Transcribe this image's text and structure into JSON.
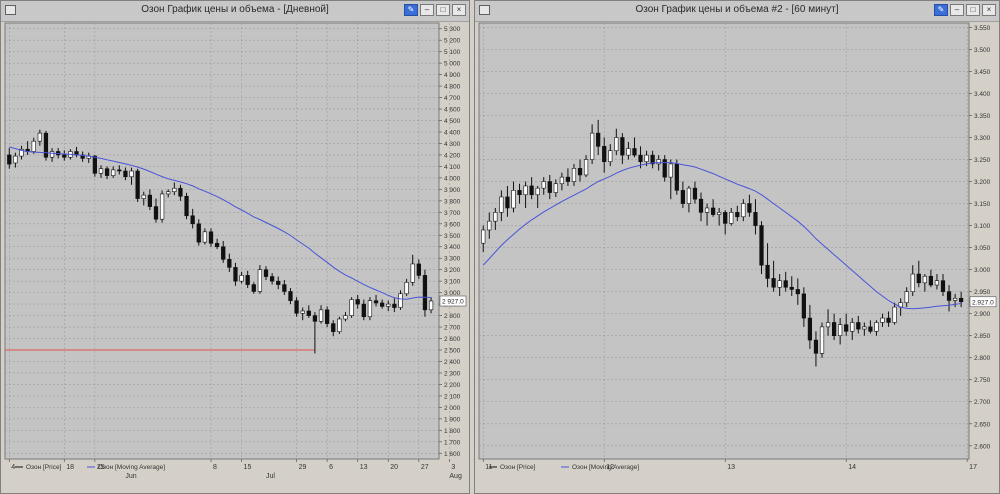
{
  "windows": [
    {
      "title": "Озон График цены и объема - [Дневной]",
      "legend": [
        "Озон [Price]",
        "Озон [Moving Average]"
      ]
    },
    {
      "title": "Озон График цены и объема #2 - [60 минут]",
      "legend": [
        "Озон [Price]",
        "Озон [Moving Average]"
      ]
    }
  ],
  "chart_data": [
    {
      "type": "candlestick",
      "timeframe": "Дневной",
      "ylim": [
        1550,
        5350
      ],
      "yticks": [
        1600,
        1700,
        1800,
        1900,
        2000,
        2100,
        2200,
        2300,
        2400,
        2500,
        2600,
        2700,
        2800,
        2900,
        3000,
        3100,
        3200,
        3300,
        3400,
        3500,
        3600,
        3700,
        3800,
        3900,
        4000,
        4100,
        4200,
        4300,
        4400,
        4500,
        4600,
        4700,
        4800,
        4900,
        5000,
        5100,
        5200,
        5300
      ],
      "ytick_labels": [
        "1 600",
        "1 700",
        "1 800",
        "1 900",
        "2 000",
        "2 100",
        "2 200",
        "2 300",
        "2 400",
        "2 500",
        "2 600",
        "2 700",
        "2 800",
        "2 900",
        "3 000",
        "3 100",
        "3 200",
        "3 300",
        "3 400",
        "3 500",
        "3 600",
        "3 700",
        "3 800",
        "3 900",
        "4 000",
        "4 100",
        "4 200",
        "4 300",
        "4 400",
        "4 500",
        "4 600",
        "4 700",
        "4 800",
        "4 900",
        "5 000",
        "5 100",
        "5 200",
        "5 300"
      ],
      "xticks": [
        {
          "label": "4",
          "index": 0
        },
        {
          "label": "18",
          "index": 9
        },
        {
          "label": "25",
          "index": 14
        },
        {
          "label": "8",
          "index": 33
        },
        {
          "label": "15",
          "index": 38
        },
        {
          "label": "29",
          "index": 47
        },
        {
          "label": "6",
          "index": 52
        },
        {
          "label": "13",
          "index": 57
        },
        {
          "label": "20",
          "index": 62
        },
        {
          "label": "27",
          "index": 67
        },
        {
          "label": "3",
          "index": 72
        },
        {
          "label": "10",
          "index": 77
        }
      ],
      "month_labels": [
        {
          "label": "Jun",
          "index": 19
        },
        {
          "label": "Jul",
          "index": 42
        },
        {
          "label": "Aug",
          "index": 72
        }
      ],
      "hline": {
        "value": 2500,
        "color": "#e05050"
      },
      "last_price_label": "2 927.0",
      "last_price": 2927,
      "price_series_color": "#111111",
      "ma_color": "#4a54d8",
      "candles": [
        [
          4200,
          4260,
          4080,
          4120
        ],
        [
          4130,
          4220,
          4090,
          4190
        ],
        [
          4190,
          4280,
          4160,
          4250
        ],
        [
          4250,
          4320,
          4200,
          4230
        ],
        [
          4230,
          4350,
          4210,
          4320
        ],
        [
          4320,
          4420,
          4280,
          4390
        ],
        [
          4390,
          4410,
          4150,
          4180
        ],
        [
          4180,
          4260,
          4140,
          4230
        ],
        [
          4230,
          4260,
          4170,
          4200
        ],
        [
          4200,
          4240,
          4150,
          4180
        ],
        [
          4180,
          4250,
          4160,
          4230
        ],
        [
          4230,
          4270,
          4180,
          4200
        ],
        [
          4200,
          4230,
          4140,
          4170
        ],
        [
          4170,
          4220,
          4130,
          4190
        ],
        [
          4190,
          4200,
          4010,
          4040
        ],
        [
          4040,
          4110,
          4000,
          4080
        ],
        [
          4080,
          4100,
          3990,
          4020
        ],
        [
          4020,
          4100,
          4000,
          4070
        ],
        [
          4070,
          4110,
          4030,
          4060
        ],
        [
          4060,
          4090,
          3980,
          4010
        ],
        [
          4010,
          4090,
          3940,
          4060
        ],
        [
          4060,
          4080,
          3790,
          3820
        ],
        [
          3820,
          3880,
          3760,
          3850
        ],
        [
          3850,
          3900,
          3720,
          3750
        ],
        [
          3750,
          3820,
          3610,
          3640
        ],
        [
          3640,
          3890,
          3610,
          3860
        ],
        [
          3860,
          3900,
          3830,
          3880
        ],
        [
          3880,
          3960,
          3850,
          3910
        ],
        [
          3910,
          3940,
          3800,
          3840
        ],
        [
          3840,
          3870,
          3640,
          3670
        ],
        [
          3670,
          3730,
          3560,
          3600
        ],
        [
          3600,
          3640,
          3410,
          3440
        ],
        [
          3440,
          3560,
          3420,
          3530
        ],
        [
          3530,
          3560,
          3400,
          3430
        ],
        [
          3430,
          3470,
          3380,
          3400
        ],
        [
          3400,
          3450,
          3260,
          3290
        ],
        [
          3290,
          3340,
          3180,
          3220
        ],
        [
          3220,
          3260,
          3060,
          3100
        ],
        [
          3100,
          3180,
          3080,
          3150
        ],
        [
          3150,
          3190,
          3040,
          3070
        ],
        [
          3070,
          3090,
          2990,
          3010
        ],
        [
          3010,
          3240,
          2990,
          3200
        ],
        [
          3200,
          3230,
          3110,
          3140
        ],
        [
          3140,
          3170,
          3070,
          3100
        ],
        [
          3100,
          3140,
          3030,
          3070
        ],
        [
          3070,
          3110,
          2980,
          3010
        ],
        [
          3010,
          3040,
          2900,
          2930
        ],
        [
          2930,
          2960,
          2790,
          2820
        ],
        [
          2820,
          2870,
          2760,
          2840
        ],
        [
          2840,
          2890,
          2780,
          2800
        ],
        [
          2800,
          2830,
          2470,
          2750
        ],
        [
          2750,
          2890,
          2730,
          2850
        ],
        [
          2850,
          2880,
          2700,
          2730
        ],
        [
          2730,
          2760,
          2620,
          2660
        ],
        [
          2660,
          2790,
          2640,
          2770
        ],
        [
          2770,
          2830,
          2750,
          2800
        ],
        [
          2800,
          2960,
          2780,
          2940
        ],
        [
          2940,
          2980,
          2860,
          2900
        ],
        [
          2900,
          2940,
          2760,
          2790
        ],
        [
          2790,
          2960,
          2760,
          2930
        ],
        [
          2930,
          2980,
          2880,
          2910
        ],
        [
          2910,
          2940,
          2860,
          2880
        ],
        [
          2880,
          2930,
          2840,
          2900
        ],
        [
          2900,
          2950,
          2830,
          2870
        ],
        [
          2870,
          3020,
          2850,
          2990
        ],
        [
          2990,
          3120,
          2970,
          3090
        ],
        [
          3090,
          3330,
          3060,
          3250
        ],
        [
          3250,
          3290,
          3120,
          3150
        ],
        [
          3150,
          3200,
          2790,
          2850
        ],
        [
          2850,
          2960,
          2820,
          2927
        ]
      ],
      "ma": [
        4270,
        4255,
        4240,
        4230,
        4225,
        4222,
        4220,
        4215,
        4212,
        4208,
        4205,
        4200,
        4196,
        4190,
        4180,
        4170,
        4158,
        4146,
        4134,
        4122,
        4110,
        4095,
        4077,
        4056,
        4032,
        4011,
        3992,
        3978,
        3965,
        3949,
        3930,
        3905,
        3884,
        3861,
        3837,
        3810,
        3780,
        3748,
        3720,
        3691,
        3660,
        3637,
        3611,
        3585,
        3559,
        3530,
        3498,
        3460,
        3424,
        3388,
        3344,
        3304,
        3264,
        3222,
        3186,
        3153,
        3128,
        3099,
        3070,
        3046,
        3023,
        3000,
        2976,
        2955,
        2945,
        2942,
        2953,
        2961,
        2959,
        2958
      ]
    },
    {
      "type": "candlestick",
      "timeframe": "60 минут",
      "ylim": [
        2570,
        3560
      ],
      "yticks": [
        2600,
        2650,
        2700,
        2750,
        2800,
        2850,
        2900,
        2950,
        3000,
        3050,
        3100,
        3150,
        3200,
        3250,
        3300,
        3350,
        3400,
        3450,
        3500,
        3550
      ],
      "ytick_labels": [
        "2.600",
        "2.650",
        "2.700",
        "2.750",
        "2.800",
        "2.850",
        "2.900",
        "2.950",
        "3.000",
        "3.050",
        "3.100",
        "3.150",
        "3.200",
        "3.250",
        "3.300",
        "3.350",
        "3.400",
        "3.450",
        "3.500",
        "3.550"
      ],
      "xticks": [
        {
          "label": "11",
          "index": 0
        },
        {
          "label": "12",
          "index": 20
        },
        {
          "label": "13",
          "index": 40
        },
        {
          "label": "14",
          "index": 60
        },
        {
          "label": "17",
          "index": 80
        },
        {
          "label": "18",
          "index": 100
        }
      ],
      "last_price_label": "2.927.0",
      "last_price": 2927,
      "price_series_color": "#111111",
      "ma_color": "#4a54d8",
      "candles": [
        [
          3060,
          3100,
          3040,
          3090
        ],
        [
          3090,
          3130,
          3070,
          3110
        ],
        [
          3110,
          3140,
          3090,
          3130
        ],
        [
          3130,
          3180,
          3110,
          3165
        ],
        [
          3165,
          3190,
          3120,
          3140
        ],
        [
          3140,
          3200,
          3130,
          3180
        ],
        [
          3180,
          3195,
          3150,
          3170
        ],
        [
          3170,
          3200,
          3140,
          3190
        ],
        [
          3190,
          3210,
          3160,
          3170
        ],
        [
          3170,
          3190,
          3140,
          3185
        ],
        [
          3185,
          3210,
          3170,
          3200
        ],
        [
          3200,
          3215,
          3160,
          3175
        ],
        [
          3175,
          3205,
          3165,
          3195
        ],
        [
          3195,
          3220,
          3180,
          3210
        ],
        [
          3210,
          3230,
          3190,
          3200
        ],
        [
          3200,
          3240,
          3190,
          3230
        ],
        [
          3230,
          3250,
          3200,
          3215
        ],
        [
          3215,
          3260,
          3210,
          3250
        ],
        [
          3250,
          3330,
          3240,
          3310
        ],
        [
          3310,
          3340,
          3260,
          3280
        ],
        [
          3280,
          3300,
          3220,
          3245
        ],
        [
          3245,
          3285,
          3235,
          3270
        ],
        [
          3270,
          3320,
          3260,
          3300
        ],
        [
          3300,
          3310,
          3240,
          3260
        ],
        [
          3260,
          3290,
          3250,
          3275
        ],
        [
          3275,
          3300,
          3255,
          3260
        ],
        [
          3260,
          3280,
          3230,
          3245
        ],
        [
          3245,
          3270,
          3235,
          3260
        ],
        [
          3260,
          3270,
          3230,
          3240
        ],
        [
          3240,
          3260,
          3225,
          3250
        ],
        [
          3250,
          3260,
          3200,
          3210
        ],
        [
          3210,
          3250,
          3160,
          3240
        ],
        [
          3240,
          3250,
          3170,
          3180
        ],
        [
          3180,
          3200,
          3140,
          3150
        ],
        [
          3150,
          3190,
          3130,
          3185
        ],
        [
          3185,
          3200,
          3150,
          3160
        ],
        [
          3160,
          3175,
          3110,
          3130
        ],
        [
          3130,
          3150,
          3100,
          3140
        ],
        [
          3140,
          3160,
          3120,
          3125
        ],
        [
          3125,
          3140,
          3100,
          3130
        ],
        [
          3130,
          3135,
          3080,
          3105
        ],
        [
          3105,
          3140,
          3100,
          3130
        ],
        [
          3130,
          3145,
          3110,
          3120
        ],
        [
          3120,
          3160,
          3110,
          3150
        ],
        [
          3150,
          3170,
          3120,
          3130
        ],
        [
          3130,
          3160,
          3080,
          3100
        ],
        [
          3100,
          3110,
          2990,
          3010
        ],
        [
          3010,
          3060,
          2960,
          2980
        ],
        [
          2980,
          3020,
          2950,
          2960
        ],
        [
          2960,
          2990,
          2940,
          2975
        ],
        [
          2975,
          2995,
          2950,
          2960
        ],
        [
          2960,
          2985,
          2940,
          2955
        ],
        [
          2955,
          2980,
          2920,
          2945
        ],
        [
          2945,
          2960,
          2870,
          2890
        ],
        [
          2890,
          2920,
          2820,
          2840
        ],
        [
          2840,
          2860,
          2780,
          2810
        ],
        [
          2810,
          2880,
          2800,
          2870
        ],
        [
          2870,
          2910,
          2850,
          2880
        ],
        [
          2880,
          2900,
          2840,
          2850
        ],
        [
          2850,
          2890,
          2830,
          2875
        ],
        [
          2875,
          2900,
          2850,
          2860
        ],
        [
          2860,
          2890,
          2840,
          2880
        ],
        [
          2880,
          2895,
          2855,
          2865
        ],
        [
          2865,
          2880,
          2850,
          2870
        ],
        [
          2870,
          2885,
          2855,
          2860
        ],
        [
          2860,
          2885,
          2850,
          2880
        ],
        [
          2880,
          2900,
          2870,
          2890
        ],
        [
          2890,
          2905,
          2870,
          2880
        ],
        [
          2880,
          2925,
          2875,
          2915
        ],
        [
          2915,
          2935,
          2895,
          2925
        ],
        [
          2925,
          2960,
          2915,
          2950
        ],
        [
          2950,
          3010,
          2940,
          2990
        ],
        [
          2990,
          3020,
          2960,
          2970
        ],
        [
          2970,
          2990,
          2950,
          2985
        ],
        [
          2985,
          3000,
          2960,
          2965
        ],
        [
          2965,
          2990,
          2955,
          2975
        ],
        [
          2975,
          2990,
          2940,
          2950
        ],
        [
          2950,
          2965,
          2905,
          2930
        ],
        [
          2930,
          2945,
          2915,
          2935
        ],
        [
          2935,
          2950,
          2915,
          2927
        ]
      ],
      "ma": [
        3010,
        3025,
        3040,
        3055,
        3068,
        3080,
        3092,
        3103,
        3113,
        3122,
        3131,
        3139,
        3147,
        3155,
        3162,
        3169,
        3176,
        3183,
        3192,
        3200,
        3206,
        3212,
        3219,
        3225,
        3230,
        3234,
        3237,
        3240,
        3242,
        3243,
        3243,
        3243,
        3241,
        3238,
        3236,
        3233,
        3228,
        3223,
        3218,
        3212,
        3206,
        3200,
        3194,
        3189,
        3184,
        3178,
        3170,
        3160,
        3150,
        3140,
        3130,
        3120,
        3110,
        3098,
        3085,
        3070,
        3058,
        3046,
        3034,
        3022,
        3010,
        2998,
        2986,
        2974,
        2962,
        2950,
        2940,
        2930,
        2922,
        2915,
        2912,
        2911,
        2912,
        2913,
        2915,
        2917,
        2918,
        2919,
        2921,
        2923
      ]
    }
  ]
}
